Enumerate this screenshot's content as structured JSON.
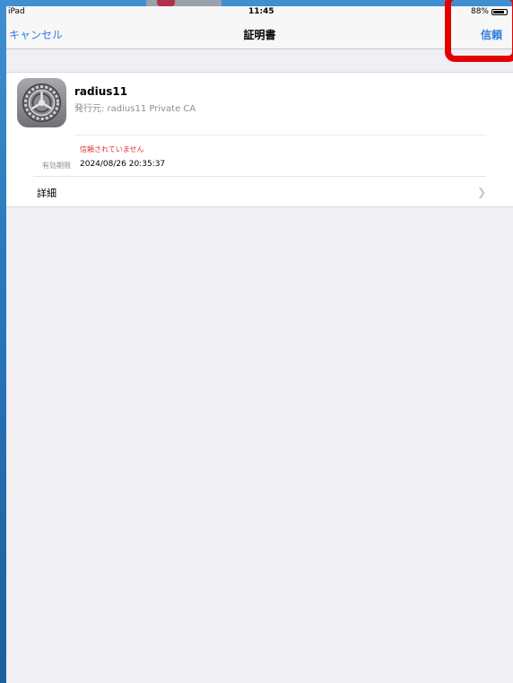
{
  "status_bar": {
    "carrier": "iPad",
    "time": "11:45",
    "battery_text": "88%"
  },
  "nav": {
    "cancel_label": "キャンセル",
    "title": "証明書",
    "trust_label": "信頼"
  },
  "certificate": {
    "name": "radius11",
    "issuer": "発行元: radius11 Private CA",
    "trust_status": "信頼されていません",
    "expiry_label": "有効期限",
    "expiry_value": "2024/08/26 20:35:37",
    "details_label": "詳細",
    "icon": "settings-gear-icon"
  },
  "colors": {
    "accent": "#2f7de1",
    "warning": "#e0302f",
    "highlight": "#e30000"
  }
}
